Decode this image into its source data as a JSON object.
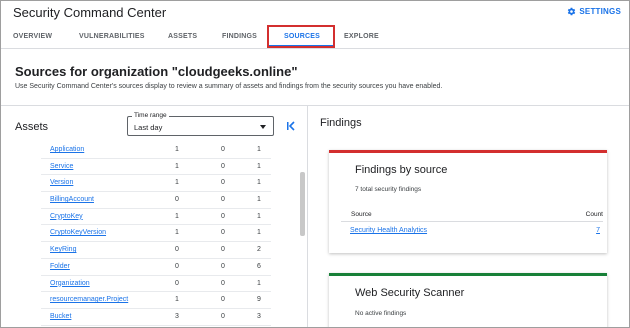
{
  "header": {
    "app_title": "Security Command Center",
    "settings_label": "SETTINGS"
  },
  "tabs": [
    {
      "label": "OVERVIEW"
    },
    {
      "label": "VULNERABILITIES"
    },
    {
      "label": "ASSETS"
    },
    {
      "label": "FINDINGS"
    },
    {
      "label": "SOURCES",
      "active": true
    },
    {
      "label": "EXPLORE"
    }
  ],
  "page": {
    "title": "Sources for organization \"cloudgeeks.online\"",
    "description": "Use Security Command Center's sources display to review a summary of assets and findings from the security sources you have enabled."
  },
  "assets": {
    "title": "Assets",
    "time_range": {
      "label": "Time range",
      "value": "Last day"
    },
    "rows": [
      {
        "name": "Application",
        "c1": "1",
        "c2": "0",
        "c3": "1"
      },
      {
        "name": "Service",
        "c1": "1",
        "c2": "0",
        "c3": "1"
      },
      {
        "name": "Version",
        "c1": "1",
        "c2": "0",
        "c3": "1"
      },
      {
        "name": "BillingAccount",
        "c1": "0",
        "c2": "0",
        "c3": "1"
      },
      {
        "name": "CryptoKey",
        "c1": "1",
        "c2": "0",
        "c3": "1"
      },
      {
        "name": "CryptoKeyVersion",
        "c1": "1",
        "c2": "0",
        "c3": "1"
      },
      {
        "name": "KeyRing",
        "c1": "0",
        "c2": "0",
        "c3": "2"
      },
      {
        "name": "Folder",
        "c1": "0",
        "c2": "0",
        "c3": "6"
      },
      {
        "name": "Organization",
        "c1": "0",
        "c2": "0",
        "c3": "1"
      },
      {
        "name": "resourcemanager.Project",
        "c1": "1",
        "c2": "0",
        "c3": "9"
      },
      {
        "name": "Bucket",
        "c1": "3",
        "c2": "0",
        "c3": "3"
      }
    ]
  },
  "findings": {
    "title": "Findings",
    "by_source": {
      "title": "Findings by source",
      "subtitle": "7 total security findings",
      "col_source": "Source",
      "col_count": "Count",
      "rows": [
        {
          "source": "Security Health Analytics",
          "count": "7"
        }
      ]
    },
    "web_scanner": {
      "title": "Web Security Scanner",
      "subtitle": "No active findings"
    }
  },
  "colors": {
    "accent": "#1a73e8",
    "highlight_box": "#d32f2f",
    "card1_bar": "#d32f2f",
    "card2_bar": "#188038"
  },
  "icons": {
    "settings": "gear-icon",
    "collapse": "collapse-left-icon",
    "dropdown": "caret-down-icon"
  }
}
